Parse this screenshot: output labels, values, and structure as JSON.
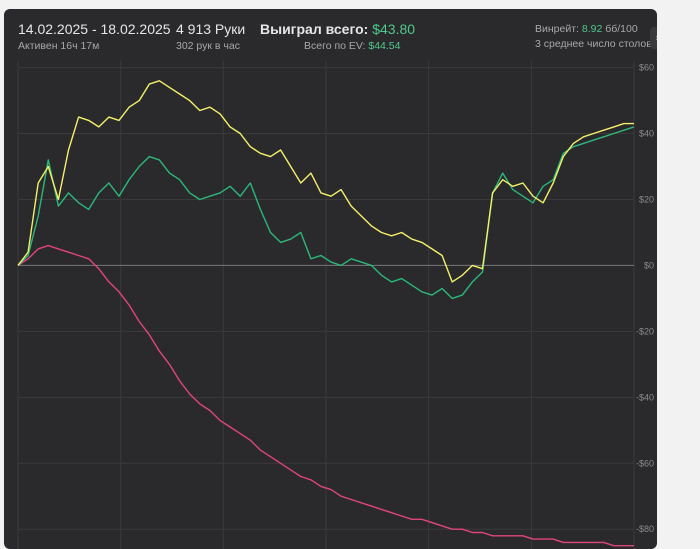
{
  "header": {
    "date_range": "14.02.2025 - 18.02.2025",
    "active_time": "Активен 16ч 17м",
    "hands_count": "4 913 Руки",
    "hands_rate": "302 рук в час",
    "won_label": "Выиграл всего:",
    "won_value": "$43.80",
    "ev_label": "Всего по EV:",
    "ev_value": "$44.54",
    "winrate_label": "Винрейт:",
    "winrate_value": "8.92",
    "winrate_unit": "бб/100",
    "avg_tables": "3 среднее число столов"
  },
  "colors": {
    "background": "#2a2a2c",
    "won": "#f4f06a",
    "ev": "#2bb87a",
    "nonshowdown": "#e0457a",
    "green_text": "#4ec98b"
  },
  "icons": {
    "settings": "gear-icon"
  },
  "chart_data": {
    "type": "line",
    "x": [
      0,
      80,
      160,
      240,
      320,
      400,
      480,
      560,
      640,
      720,
      800,
      880,
      960,
      1040,
      1120,
      1200,
      1280,
      1360,
      1440,
      1520,
      1600,
      1680,
      1760,
      1840,
      1920,
      2000,
      2080,
      2160,
      2240,
      2320,
      2400,
      2480,
      2560,
      2640,
      2720,
      2800,
      2880,
      2960,
      3040,
      3120,
      3200,
      3280,
      3360,
      3440,
      3520,
      3600,
      3680,
      3760,
      3840,
      3920,
      4000,
      4080,
      4160,
      4240,
      4320,
      4400,
      4480,
      4560,
      4640,
      4720,
      4800,
      4880
    ],
    "ylim": [
      -86,
      62
    ],
    "yticks": [
      "$60",
      "$40",
      "$20",
      "$0",
      "-$20",
      "-$40",
      "-$60",
      "-$80"
    ],
    "ytick_values": [
      60,
      40,
      20,
      0,
      -20,
      -40,
      -60,
      -80
    ],
    "series": [
      {
        "color": "#f4f06a",
        "values": [
          0,
          4,
          25,
          30,
          20,
          35,
          45,
          44,
          42,
          45,
          44,
          48,
          50,
          55,
          56,
          54,
          52,
          50,
          47,
          48,
          46,
          42,
          40,
          36,
          34,
          33,
          35,
          30,
          25,
          28,
          22,
          21,
          23,
          18,
          15,
          12,
          10,
          9,
          10,
          8,
          7,
          5,
          3,
          -5,
          -3,
          0,
          -1,
          22,
          26,
          24,
          25,
          21,
          19,
          25,
          33,
          37,
          39,
          40,
          41,
          42,
          43,
          43
        ]
      },
      {
        "color": "#2bb87a",
        "values": [
          0,
          3,
          15,
          32,
          18,
          22,
          19,
          17,
          22,
          25,
          21,
          26,
          30,
          33,
          32,
          28,
          26,
          22,
          20,
          21,
          22,
          24,
          21,
          25,
          17,
          10,
          7,
          8,
          10,
          2,
          3,
          1,
          0,
          2,
          1,
          0,
          -3,
          -5,
          -4,
          -6,
          -8,
          -9,
          -7,
          -10,
          -9,
          -5,
          -2,
          22,
          28,
          23,
          21,
          19,
          24,
          26,
          34,
          36,
          37,
          38,
          39,
          40,
          41,
          42
        ]
      },
      {
        "color": "#e0457a",
        "values": [
          0,
          2,
          5,
          6,
          5,
          4,
          3,
          2,
          -1,
          -5,
          -8,
          -12,
          -17,
          -21,
          -26,
          -30,
          -35,
          -39,
          -42,
          -44,
          -47,
          -49,
          -51,
          -53,
          -56,
          -58,
          -60,
          -62,
          -64,
          -65,
          -67,
          -68,
          -70,
          -71,
          -72,
          -73,
          -74,
          -75,
          -76,
          -77,
          -77,
          -78,
          -79,
          -80,
          -80,
          -81,
          -81,
          -82,
          -82,
          -82,
          -82,
          -83,
          -83,
          -83,
          -84,
          -84,
          -84,
          -84,
          -84,
          -85,
          -85,
          -85
        ]
      }
    ]
  }
}
